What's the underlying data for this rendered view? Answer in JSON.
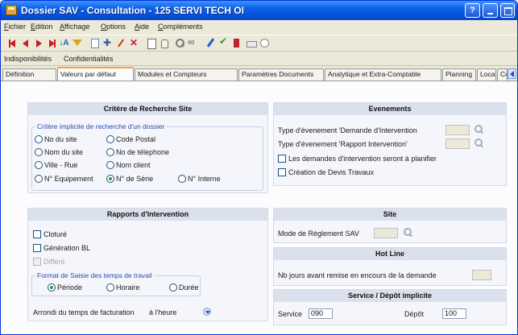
{
  "window": {
    "title": "Dossier SAV - Consultation - 125 SERVI TECH OI",
    "help_button": "?"
  },
  "menu": {
    "items": [
      {
        "underline": "F",
        "rest": "ichier"
      },
      {
        "underline": "E",
        "rest": "dition"
      },
      {
        "underline": "A",
        "rest": "ffichage"
      },
      {
        "underline": "O",
        "rest": "ptions"
      },
      {
        "underline": "A",
        "rest": "ide"
      },
      {
        "underline": "C",
        "rest": "ompléments"
      }
    ]
  },
  "toolbar": {
    "icons": [
      "first-record-icon",
      "previous-record-icon",
      "next-record-icon",
      "last-record-icon",
      "sort-icon",
      "filter-icon",
      "copy-icon",
      "add-icon",
      "edit-wand-icon",
      "delete-icon",
      "document-icon",
      "hand-icon",
      "search-icon",
      "binoculars-icon",
      "pen-icon",
      "validate-icon",
      "exit-icon",
      "print-icon",
      "clock-icon"
    ],
    "sort_glyph": "↓A"
  },
  "subbar": {
    "indisponibilites": "Indisponibilités",
    "confidentialites": "Confidentialités"
  },
  "tabs": [
    {
      "label": "Définition",
      "active": false
    },
    {
      "label": "Valeurs par défaut",
      "active": true
    },
    {
      "label": "Modules et Compteurs",
      "active": false
    },
    {
      "label": "Paramètres Documents",
      "active": false
    },
    {
      "label": "Analytique et Extra-Comptable",
      "active": false
    },
    {
      "label": "Planning",
      "active": false
    },
    {
      "label": "Location",
      "active": false
    },
    {
      "label": "Cc",
      "active": false
    }
  ],
  "critere": {
    "header": "Critère de Recherche Site",
    "legend": "Critère implicite de recherche d'un dossier",
    "options": [
      {
        "label": "No du site",
        "selected": false
      },
      {
        "label": "Code Postal",
        "selected": false
      },
      {
        "label": "Nom du site",
        "selected": false
      },
      {
        "label": "No de télephone",
        "selected": false
      },
      {
        "label": "Ville - Rue",
        "selected": false
      },
      {
        "label": "Nom client",
        "selected": false
      },
      {
        "label": "N° Equipement",
        "selected": false
      },
      {
        "label": "N° de Série",
        "selected": true
      },
      {
        "label": "N° Interne",
        "selected": false
      }
    ]
  },
  "evenements": {
    "header": "Evenements",
    "type_demande_label": "Type d'évenement  'Demande d'Intervention",
    "type_demande_value": "",
    "type_rapport_label": "Type d'évenement 'Rapport Intervention'",
    "type_rapport_value": "",
    "planifier_label": "Les demandes d'intervention seront à planifier",
    "planifier_checked": false,
    "devis_label": "Création de Devis Travaux",
    "devis_checked": false
  },
  "rapports": {
    "header": "Rapports d'Intervention",
    "cloture_label": "Cloturé",
    "cloture_checked": false,
    "generation_label": "Génération BL",
    "generation_checked": false,
    "differe_label": "Différé",
    "differe_checked": false,
    "format_legend": "Format de Saisie des temps de travail",
    "format_options": [
      {
        "label": "Période",
        "selected": true
      },
      {
        "label": "Horaire",
        "selected": false
      },
      {
        "label": "Durée",
        "selected": false
      }
    ],
    "arrondi_label": "Arrondi du temps de facturation",
    "arrondi_value": "à l'heure"
  },
  "site": {
    "header": "Site",
    "mode_label": "Mode de Règlement SAV",
    "mode_value": ""
  },
  "hotline": {
    "header": "Hot Line",
    "jours_label": "Nb jours avant remise en encours de la demande",
    "jours_value": ""
  },
  "service": {
    "header": "Service / Dépôt implicite",
    "service_label": "Service",
    "service_value": "090",
    "depot_label": "Dépôt",
    "depot_value": "100"
  }
}
